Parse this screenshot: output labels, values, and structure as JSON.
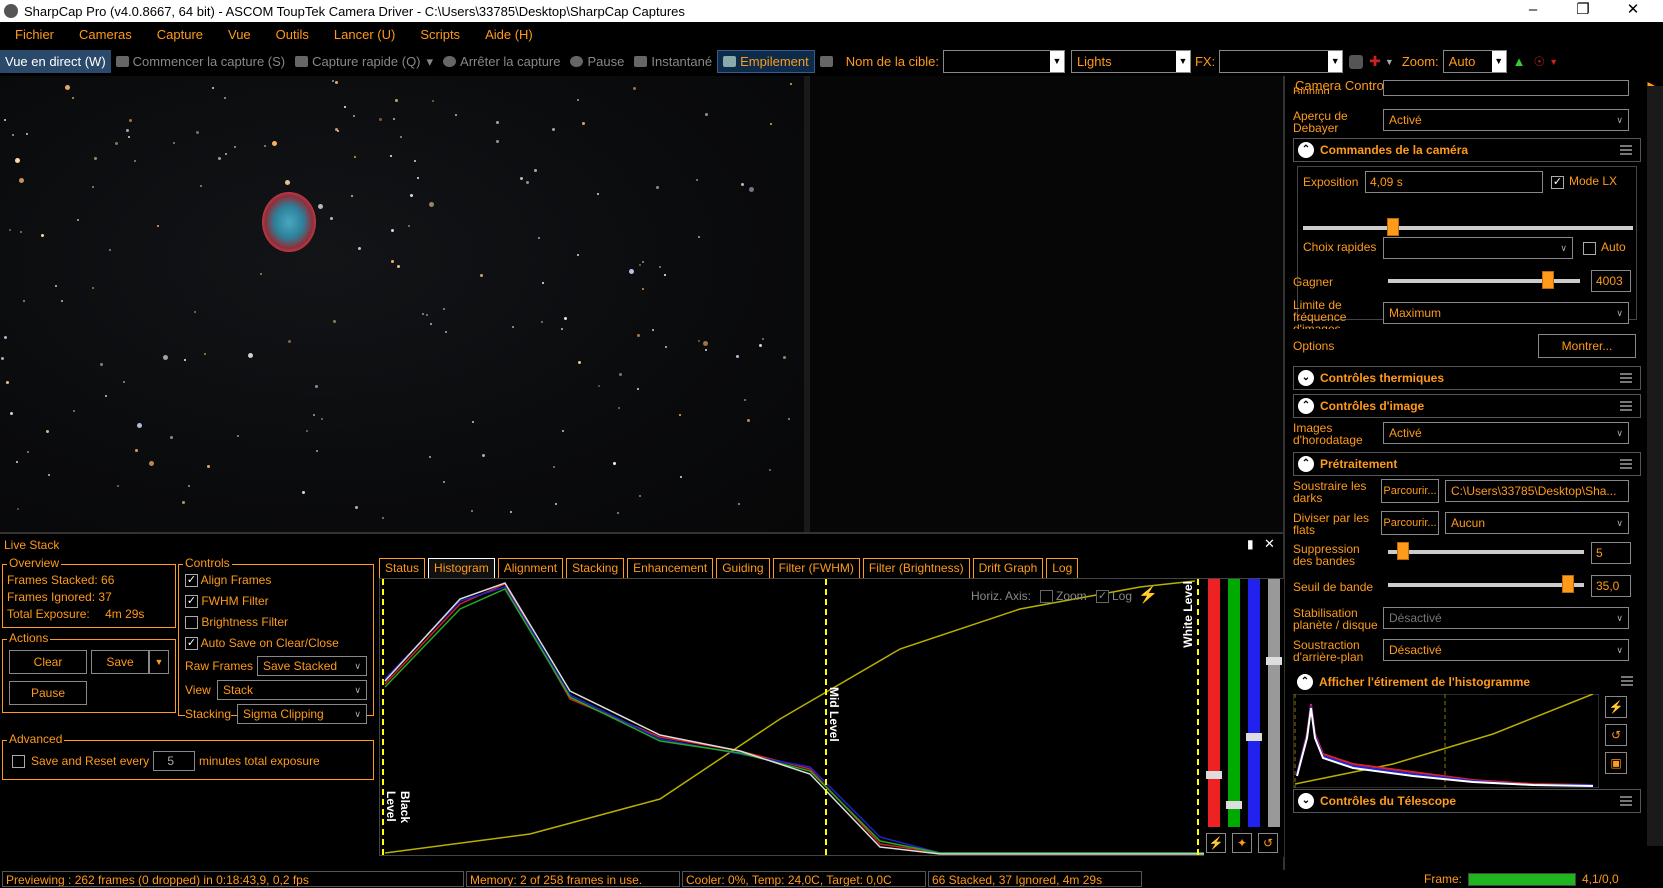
{
  "titlebar": {
    "title": "SharpCap Pro (v4.0.8667, 64 bit) - ASCOM ToupTek Camera Driver - C:\\Users\\33785\\Desktop\\SharpCap Captures"
  },
  "menu": [
    "Fichier",
    "Cameras",
    "Capture",
    "Vue",
    "Outils",
    "Lancer (U)",
    "Scripts",
    "Aide (H)"
  ],
  "toolbar": {
    "live_view": "Vue en direct (W)",
    "start_capture": "Commencer la capture (S)",
    "quick_capture": "Capture rapide (Q)",
    "stop_capture": "Arrêter la capture",
    "pause": "Pause",
    "snapshot": "Instantané",
    "stacking": "Empilement",
    "target_label": "Nom de la cible:",
    "target_value": "",
    "frame_type": "Lights",
    "fx_label": "FX:",
    "fx_value": "",
    "zoom_label": "Zoom:",
    "zoom_value": "Auto"
  },
  "camera_panel": {
    "title": "Camera Control Panel",
    "binning_label": "Binning",
    "debayer_label": "Aperçu de Debayer",
    "debayer_value": "Activé",
    "camera_controls": "Commandes de la caméra",
    "exposure_label": "Exposition",
    "exposure_value": "4,09 s",
    "lx_mode": "Mode LX",
    "quick_choice_label": "Choix rapides",
    "quick_choice_value": "",
    "auto_label": "Auto",
    "gain_label": "Gagner",
    "gain_value": "4003",
    "framerate_label": "Limite de fréquence d'images",
    "framerate_value": "Maximum",
    "options_label": "Options",
    "options_button": "Montrer...",
    "thermal": "Contrôles thermiques",
    "image_controls": "Contrôles d'image",
    "timestamp_label": "Images d'horodatage",
    "timestamp_value": "Activé",
    "preprocessing": "Prétraitement",
    "darks_label": "Soustraire les darks",
    "browse1": "Parcourir...",
    "darks_value": "C:\\Users\\33785\\Desktop\\Sha...",
    "flats_label": "Diviser par les flats",
    "browse2": "Parcourir...",
    "flats_value": "Aucun",
    "banding_label": "Suppression des bandes",
    "banding_value": "5",
    "band_threshold_label": "Seuil de bande",
    "band_threshold_value": "35,0",
    "stabilization_label": "Stabilisation planète / disque",
    "stabilization_value": "Désactivé",
    "background_label": "Soustraction d'arrière-plan",
    "background_value": "Désactivé",
    "histogram_stretch": "Afficher l'étirement de l'histogramme",
    "telescope": "Contrôles du Télescope"
  },
  "livestack": {
    "title": "Live Stack",
    "overview_caption": "Overview",
    "frames_stacked_label": "Frames Stacked:",
    "frames_stacked": "66",
    "frames_ignored_label": "Frames Ignored:",
    "frames_ignored": "37",
    "total_exposure_label": "Total Exposure:",
    "total_exposure": "4m 29s",
    "actions_caption": "Actions",
    "clear": "Clear",
    "save": "Save",
    "pause": "Pause",
    "controls_caption": "Controls",
    "align_frames": "Align Frames",
    "fwhm_filter": "FWHM Filter",
    "brightness_filter": "Brightness Filter",
    "auto_save": "Auto Save on Clear/Close",
    "raw_frames_label": "Raw Frames",
    "raw_frames_value": "Save Stacked",
    "view_label": "View",
    "view_value": "Stack",
    "stacking_label": "Stacking",
    "stacking_value": "Sigma Clipping",
    "advanced_caption": "Advanced",
    "save_reset_label": "Save and Reset every",
    "save_reset_value": "5",
    "minutes_label": "minutes total exposure",
    "tabs": [
      "Status",
      "Histogram",
      "Alignment",
      "Stacking",
      "Enhancement",
      "Guiding",
      "Filter (FWHM)",
      "Filter (Brightness)",
      "Drift Graph",
      "Log"
    ],
    "horiz_axis": "Horiz. Axis:",
    "zoom": "Zoom",
    "log": "Log",
    "black_level": "Black Level",
    "mid_level": "Mid Level",
    "white_level": "White Level"
  },
  "status": {
    "preview": "Previewing : 262 frames (0 dropped) in 0:18:43,9, 0,2 fps",
    "memory": "Memory: 2 of 258 frames in use.",
    "cooler": "Cooler: 0%, Temp: 24,0C, Target: 0,0C",
    "stack": "66 Stacked, 37 Ignored, 4m 29s",
    "frame_label": "Frame:",
    "frame_value": "4,1/0,0"
  }
}
